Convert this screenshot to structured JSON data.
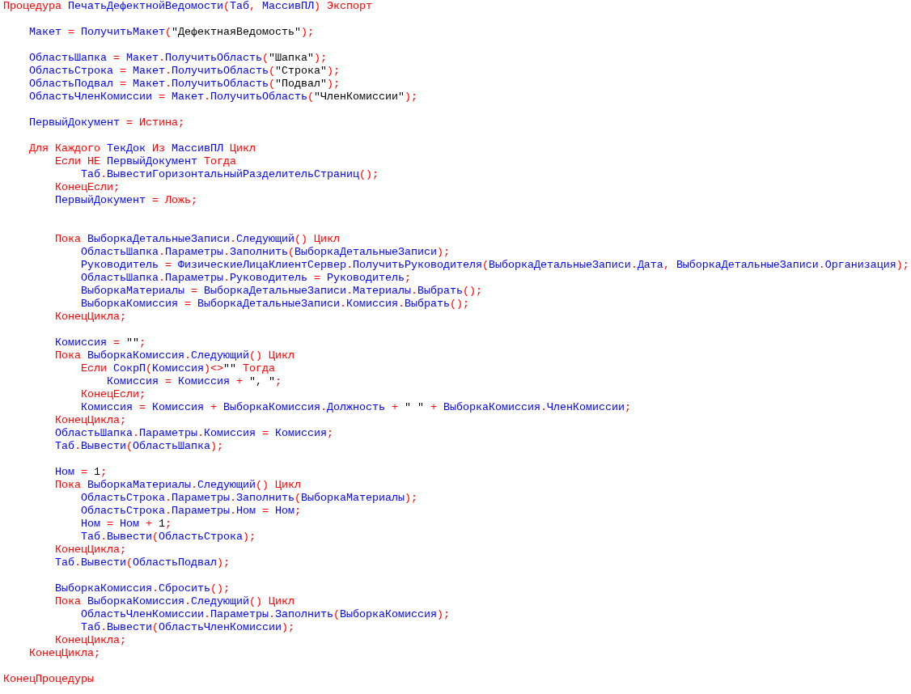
{
  "code_lines": [
    {
      "kind": "code",
      "tokens": [
        {
          "kind": "kw",
          "text": "Процедура"
        },
        {
          "kind": "id",
          "text": " ПечатьДефектнойВедомости"
        },
        {
          "kind": "op",
          "text": "("
        },
        {
          "kind": "id",
          "text": "Таб"
        },
        {
          "kind": "op",
          "text": ", "
        },
        {
          "kind": "id",
          "text": "МассивПЛ"
        },
        {
          "kind": "op",
          "text": ")"
        },
        {
          "kind": "kw",
          "text": " Экспорт"
        }
      ],
      "children": [
        {
          "kind": "blank"
        },
        {
          "kind": "code",
          "tokens": [
            {
              "kind": "id",
              "text": "Макет"
            },
            {
              "kind": "op",
              "text": " = "
            },
            {
              "kind": "id",
              "text": "ПолучитьМакет"
            },
            {
              "kind": "op",
              "text": "("
            },
            {
              "kind": "lit",
              "text": "\"ДефектнаяВедомость\""
            },
            {
              "kind": "op",
              "text": ");"
            }
          ]
        },
        {
          "kind": "blank"
        },
        {
          "kind": "code",
          "tokens": [
            {
              "kind": "id",
              "text": "ОбластьШапка"
            },
            {
              "kind": "op",
              "text": " = "
            },
            {
              "kind": "id",
              "text": "Макет"
            },
            {
              "kind": "op",
              "text": "."
            },
            {
              "kind": "id",
              "text": "ПолучитьОбласть"
            },
            {
              "kind": "op",
              "text": "("
            },
            {
              "kind": "lit",
              "text": "\"Шапка\""
            },
            {
              "kind": "op",
              "text": ");"
            }
          ]
        },
        {
          "kind": "code",
          "tokens": [
            {
              "kind": "id",
              "text": "ОбластьСтрока"
            },
            {
              "kind": "op",
              "text": " = "
            },
            {
              "kind": "id",
              "text": "Макет"
            },
            {
              "kind": "op",
              "text": "."
            },
            {
              "kind": "id",
              "text": "ПолучитьОбласть"
            },
            {
              "kind": "op",
              "text": "("
            },
            {
              "kind": "lit",
              "text": "\"Строка\""
            },
            {
              "kind": "op",
              "text": ");"
            }
          ]
        },
        {
          "kind": "code",
          "tokens": [
            {
              "kind": "id",
              "text": "ОбластьПодвал"
            },
            {
              "kind": "op",
              "text": " = "
            },
            {
              "kind": "id",
              "text": "Макет"
            },
            {
              "kind": "op",
              "text": "."
            },
            {
              "kind": "id",
              "text": "ПолучитьОбласть"
            },
            {
              "kind": "op",
              "text": "("
            },
            {
              "kind": "lit",
              "text": "\"Подвал\""
            },
            {
              "kind": "op",
              "text": ");"
            }
          ]
        },
        {
          "kind": "code",
          "tokens": [
            {
              "kind": "id",
              "text": "ОбластьЧленКомиссии"
            },
            {
              "kind": "op",
              "text": " = "
            },
            {
              "kind": "id",
              "text": "Макет"
            },
            {
              "kind": "op",
              "text": "."
            },
            {
              "kind": "id",
              "text": "ПолучитьОбласть"
            },
            {
              "kind": "op",
              "text": "("
            },
            {
              "kind": "lit",
              "text": "\"ЧленКомиссии\""
            },
            {
              "kind": "op",
              "text": ");"
            }
          ]
        },
        {
          "kind": "blank"
        },
        {
          "kind": "code",
          "tokens": [
            {
              "kind": "id",
              "text": "ПервыйДокумент"
            },
            {
              "kind": "op",
              "text": " = "
            },
            {
              "kind": "kw",
              "text": "Истина"
            },
            {
              "kind": "op",
              "text": ";"
            }
          ]
        },
        {
          "kind": "blank"
        },
        {
          "kind": "code",
          "tokens": [
            {
              "kind": "kw",
              "text": "Для Каждого"
            },
            {
              "kind": "id",
              "text": " ТекДок"
            },
            {
              "kind": "kw",
              "text": " Из"
            },
            {
              "kind": "id",
              "text": " МассивПЛ"
            },
            {
              "kind": "kw",
              "text": " Цикл"
            }
          ],
          "children": [
            {
              "kind": "code",
              "tokens": [
                {
                  "kind": "kw",
                  "text": "Если НЕ"
                },
                {
                  "kind": "id",
                  "text": " ПервыйДокумент"
                },
                {
                  "kind": "kw",
                  "text": " Тогда"
                }
              ],
              "children": [
                {
                  "kind": "code",
                  "tokens": [
                    {
                      "kind": "id",
                      "text": "Таб"
                    },
                    {
                      "kind": "op",
                      "text": "."
                    },
                    {
                      "kind": "id",
                      "text": "ВывестиГоризонтальныйРазделительСтраниц"
                    },
                    {
                      "kind": "op",
                      "text": "();"
                    }
                  ]
                }
              ]
            },
            {
              "kind": "code",
              "tokens": [
                {
                  "kind": "kw",
                  "text": "КонецЕсли"
                },
                {
                  "kind": "op",
                  "text": ";"
                }
              ]
            },
            {
              "kind": "code",
              "tokens": [
                {
                  "kind": "id",
                  "text": "ПервыйДокумент"
                },
                {
                  "kind": "op",
                  "text": " = "
                },
                {
                  "kind": "kw",
                  "text": "Ложь"
                },
                {
                  "kind": "op",
                  "text": ";"
                }
              ]
            },
            {
              "kind": "blank"
            },
            {
              "kind": "blank"
            },
            {
              "kind": "code",
              "tokens": [
                {
                  "kind": "kw",
                  "text": "Пока"
                },
                {
                  "kind": "id",
                  "text": " ВыборкаДетальныеЗаписи"
                },
                {
                  "kind": "op",
                  "text": "."
                },
                {
                  "kind": "id",
                  "text": "Следующий"
                },
                {
                  "kind": "op",
                  "text": "()"
                },
                {
                  "kind": "kw",
                  "text": " Цикл"
                }
              ],
              "children": [
                {
                  "kind": "code",
                  "tokens": [
                    {
                      "kind": "id",
                      "text": "ОбластьШапка"
                    },
                    {
                      "kind": "op",
                      "text": "."
                    },
                    {
                      "kind": "id",
                      "text": "Параметры"
                    },
                    {
                      "kind": "op",
                      "text": "."
                    },
                    {
                      "kind": "id",
                      "text": "Заполнить"
                    },
                    {
                      "kind": "op",
                      "text": "("
                    },
                    {
                      "kind": "id",
                      "text": "ВыборкаДетальныеЗаписи"
                    },
                    {
                      "kind": "op",
                      "text": ");"
                    }
                  ]
                },
                {
                  "kind": "code",
                  "tokens": [
                    {
                      "kind": "id",
                      "text": "Руководитель"
                    },
                    {
                      "kind": "op",
                      "text": " = "
                    },
                    {
                      "kind": "id",
                      "text": "ФизическиеЛицаКлиентСервер"
                    },
                    {
                      "kind": "op",
                      "text": "."
                    },
                    {
                      "kind": "id",
                      "text": "ПолучитьРуководителя"
                    },
                    {
                      "kind": "op",
                      "text": "("
                    },
                    {
                      "kind": "id",
                      "text": "ВыборкаДетальныеЗаписи"
                    },
                    {
                      "kind": "op",
                      "text": "."
                    },
                    {
                      "kind": "id",
                      "text": "Дата"
                    },
                    {
                      "kind": "op",
                      "text": ", "
                    },
                    {
                      "kind": "id",
                      "text": "ВыборкаДетальныеЗаписи"
                    },
                    {
                      "kind": "op",
                      "text": "."
                    },
                    {
                      "kind": "id",
                      "text": "Организация"
                    },
                    {
                      "kind": "op",
                      "text": ");"
                    }
                  ]
                },
                {
                  "kind": "code",
                  "tokens": [
                    {
                      "kind": "id",
                      "text": "ОбластьШапка"
                    },
                    {
                      "kind": "op",
                      "text": "."
                    },
                    {
                      "kind": "id",
                      "text": "Параметры"
                    },
                    {
                      "kind": "op",
                      "text": "."
                    },
                    {
                      "kind": "id",
                      "text": "Руководитель"
                    },
                    {
                      "kind": "op",
                      "text": " = "
                    },
                    {
                      "kind": "id",
                      "text": "Руководитель"
                    },
                    {
                      "kind": "op",
                      "text": ";"
                    }
                  ]
                },
                {
                  "kind": "code",
                  "tokens": [
                    {
                      "kind": "id",
                      "text": "ВыборкаМатериалы"
                    },
                    {
                      "kind": "op",
                      "text": " = "
                    },
                    {
                      "kind": "id",
                      "text": "ВыборкаДетальныеЗаписи"
                    },
                    {
                      "kind": "op",
                      "text": "."
                    },
                    {
                      "kind": "id",
                      "text": "Материалы"
                    },
                    {
                      "kind": "op",
                      "text": "."
                    },
                    {
                      "kind": "id",
                      "text": "Выбрать"
                    },
                    {
                      "kind": "op",
                      "text": "();"
                    }
                  ]
                },
                {
                  "kind": "code",
                  "tokens": [
                    {
                      "kind": "id",
                      "text": "ВыборкаКомиссия"
                    },
                    {
                      "kind": "op",
                      "text": " = "
                    },
                    {
                      "kind": "id",
                      "text": "ВыборкаДетальныеЗаписи"
                    },
                    {
                      "kind": "op",
                      "text": "."
                    },
                    {
                      "kind": "id",
                      "text": "Комиссия"
                    },
                    {
                      "kind": "op",
                      "text": "."
                    },
                    {
                      "kind": "id",
                      "text": "Выбрать"
                    },
                    {
                      "kind": "op",
                      "text": "();"
                    }
                  ]
                }
              ]
            },
            {
              "kind": "code",
              "tokens": [
                {
                  "kind": "kw",
                  "text": "КонецЦикла"
                },
                {
                  "kind": "op",
                  "text": ";"
                }
              ]
            },
            {
              "kind": "blank"
            },
            {
              "kind": "code",
              "tokens": [
                {
                  "kind": "id",
                  "text": "Комиссия"
                },
                {
                  "kind": "op",
                  "text": " = "
                },
                {
                  "kind": "lit",
                  "text": "\"\""
                },
                {
                  "kind": "op",
                  "text": ";"
                }
              ]
            },
            {
              "kind": "code",
              "tokens": [
                {
                  "kind": "kw",
                  "text": "Пока"
                },
                {
                  "kind": "id",
                  "text": " ВыборкаКомиссия"
                },
                {
                  "kind": "op",
                  "text": "."
                },
                {
                  "kind": "id",
                  "text": "Следующий"
                },
                {
                  "kind": "op",
                  "text": "()"
                },
                {
                  "kind": "kw",
                  "text": " Цикл"
                }
              ],
              "children": [
                {
                  "kind": "code",
                  "tokens": [
                    {
                      "kind": "kw",
                      "text": "Если"
                    },
                    {
                      "kind": "id",
                      "text": " СокрП"
                    },
                    {
                      "kind": "op",
                      "text": "("
                    },
                    {
                      "kind": "id",
                      "text": "Комиссия"
                    },
                    {
                      "kind": "op",
                      "text": ")<>"
                    },
                    {
                      "kind": "lit",
                      "text": "\"\""
                    },
                    {
                      "kind": "kw",
                      "text": " Тогда"
                    }
                  ],
                  "children": [
                    {
                      "kind": "code",
                      "tokens": [
                        {
                          "kind": "id",
                          "text": "Комиссия"
                        },
                        {
                          "kind": "op",
                          "text": " = "
                        },
                        {
                          "kind": "id",
                          "text": "Комиссия"
                        },
                        {
                          "kind": "op",
                          "text": " + "
                        },
                        {
                          "kind": "lit",
                          "text": "\", \""
                        },
                        {
                          "kind": "op",
                          "text": ";"
                        }
                      ]
                    }
                  ]
                },
                {
                  "kind": "code",
                  "tokens": [
                    {
                      "kind": "kw",
                      "text": "КонецЕсли"
                    },
                    {
                      "kind": "op",
                      "text": ";"
                    }
                  ]
                },
                {
                  "kind": "code",
                  "tokens": [
                    {
                      "kind": "id",
                      "text": "Комиссия"
                    },
                    {
                      "kind": "op",
                      "text": " = "
                    },
                    {
                      "kind": "id",
                      "text": "Комиссия"
                    },
                    {
                      "kind": "op",
                      "text": " + "
                    },
                    {
                      "kind": "id",
                      "text": "ВыборкаКомиссия"
                    },
                    {
                      "kind": "op",
                      "text": "."
                    },
                    {
                      "kind": "id",
                      "text": "Должность"
                    },
                    {
                      "kind": "op",
                      "text": " + "
                    },
                    {
                      "kind": "lit",
                      "text": "\" \""
                    },
                    {
                      "kind": "op",
                      "text": " + "
                    },
                    {
                      "kind": "id",
                      "text": "ВыборкаКомиссия"
                    },
                    {
                      "kind": "op",
                      "text": "."
                    },
                    {
                      "kind": "id",
                      "text": "ЧленКомиссии"
                    },
                    {
                      "kind": "op",
                      "text": ";"
                    }
                  ]
                }
              ]
            },
            {
              "kind": "code",
              "tokens": [
                {
                  "kind": "kw",
                  "text": "КонецЦикла"
                },
                {
                  "kind": "op",
                  "text": ";"
                }
              ]
            },
            {
              "kind": "code",
              "tokens": [
                {
                  "kind": "id",
                  "text": "ОбластьШапка"
                },
                {
                  "kind": "op",
                  "text": "."
                },
                {
                  "kind": "id",
                  "text": "Параметры"
                },
                {
                  "kind": "op",
                  "text": "."
                },
                {
                  "kind": "id",
                  "text": "Комиссия"
                },
                {
                  "kind": "op",
                  "text": " = "
                },
                {
                  "kind": "id",
                  "text": "Комиссия"
                },
                {
                  "kind": "op",
                  "text": ";"
                }
              ]
            },
            {
              "kind": "code",
              "tokens": [
                {
                  "kind": "id",
                  "text": "Таб"
                },
                {
                  "kind": "op",
                  "text": "."
                },
                {
                  "kind": "id",
                  "text": "Вывести"
                },
                {
                  "kind": "op",
                  "text": "("
                },
                {
                  "kind": "id",
                  "text": "ОбластьШапка"
                },
                {
                  "kind": "op",
                  "text": ");"
                }
              ]
            },
            {
              "kind": "blank"
            },
            {
              "kind": "code",
              "tokens": [
                {
                  "kind": "id",
                  "text": "Ном"
                },
                {
                  "kind": "op",
                  "text": " = "
                },
                {
                  "kind": "lit",
                  "text": "1"
                },
                {
                  "kind": "op",
                  "text": ";"
                }
              ]
            },
            {
              "kind": "code",
              "tokens": [
                {
                  "kind": "kw",
                  "text": "Пока"
                },
                {
                  "kind": "id",
                  "text": " ВыборкаМатериалы"
                },
                {
                  "kind": "op",
                  "text": "."
                },
                {
                  "kind": "id",
                  "text": "Следующий"
                },
                {
                  "kind": "op",
                  "text": "()"
                },
                {
                  "kind": "kw",
                  "text": " Цикл"
                }
              ],
              "children": [
                {
                  "kind": "code",
                  "tokens": [
                    {
                      "kind": "id",
                      "text": "ОбластьСтрока"
                    },
                    {
                      "kind": "op",
                      "text": "."
                    },
                    {
                      "kind": "id",
                      "text": "Параметры"
                    },
                    {
                      "kind": "op",
                      "text": "."
                    },
                    {
                      "kind": "id",
                      "text": "Заполнить"
                    },
                    {
                      "kind": "op",
                      "text": "("
                    },
                    {
                      "kind": "id",
                      "text": "ВыборкаМатериалы"
                    },
                    {
                      "kind": "op",
                      "text": ");"
                    }
                  ]
                },
                {
                  "kind": "code",
                  "tokens": [
                    {
                      "kind": "id",
                      "text": "ОбластьСтрока"
                    },
                    {
                      "kind": "op",
                      "text": "."
                    },
                    {
                      "kind": "id",
                      "text": "Параметры"
                    },
                    {
                      "kind": "op",
                      "text": "."
                    },
                    {
                      "kind": "id",
                      "text": "Ном"
                    },
                    {
                      "kind": "op",
                      "text": " = "
                    },
                    {
                      "kind": "id",
                      "text": "Ном"
                    },
                    {
                      "kind": "op",
                      "text": ";"
                    }
                  ]
                },
                {
                  "kind": "code",
                  "tokens": [
                    {
                      "kind": "id",
                      "text": "Ном"
                    },
                    {
                      "kind": "op",
                      "text": " = "
                    },
                    {
                      "kind": "id",
                      "text": "Ном"
                    },
                    {
                      "kind": "op",
                      "text": " + "
                    },
                    {
                      "kind": "lit",
                      "text": "1"
                    },
                    {
                      "kind": "op",
                      "text": ";"
                    }
                  ]
                },
                {
                  "kind": "code",
                  "tokens": [
                    {
                      "kind": "id",
                      "text": "Таб"
                    },
                    {
                      "kind": "op",
                      "text": "."
                    },
                    {
                      "kind": "id",
                      "text": "Вывести"
                    },
                    {
                      "kind": "op",
                      "text": "("
                    },
                    {
                      "kind": "id",
                      "text": "ОбластьСтрока"
                    },
                    {
                      "kind": "op",
                      "text": ");"
                    }
                  ]
                }
              ]
            },
            {
              "kind": "code",
              "tokens": [
                {
                  "kind": "kw",
                  "text": "КонецЦикла"
                },
                {
                  "kind": "op",
                  "text": ";"
                }
              ]
            },
            {
              "kind": "code",
              "tokens": [
                {
                  "kind": "id",
                  "text": "Таб"
                },
                {
                  "kind": "op",
                  "text": "."
                },
                {
                  "kind": "id",
                  "text": "Вывести"
                },
                {
                  "kind": "op",
                  "text": "("
                },
                {
                  "kind": "id",
                  "text": "ОбластьПодвал"
                },
                {
                  "kind": "op",
                  "text": ");"
                }
              ]
            },
            {
              "kind": "blank"
            },
            {
              "kind": "code",
              "tokens": [
                {
                  "kind": "id",
                  "text": "ВыборкаКомиссия"
                },
                {
                  "kind": "op",
                  "text": "."
                },
                {
                  "kind": "id",
                  "text": "Сбросить"
                },
                {
                  "kind": "op",
                  "text": "();"
                }
              ]
            },
            {
              "kind": "code",
              "tokens": [
                {
                  "kind": "kw",
                  "text": "Пока"
                },
                {
                  "kind": "id",
                  "text": " ВыборкаКомиссия"
                },
                {
                  "kind": "op",
                  "text": "."
                },
                {
                  "kind": "id",
                  "text": "Следующий"
                },
                {
                  "kind": "op",
                  "text": "()"
                },
                {
                  "kind": "kw",
                  "text": " Цикл"
                }
              ],
              "children": [
                {
                  "kind": "code",
                  "tokens": [
                    {
                      "kind": "id",
                      "text": "ОбластьЧленКомиссии"
                    },
                    {
                      "kind": "op",
                      "text": "."
                    },
                    {
                      "kind": "id",
                      "text": "Параметры"
                    },
                    {
                      "kind": "op",
                      "text": "."
                    },
                    {
                      "kind": "id",
                      "text": "Заполнить"
                    },
                    {
                      "kind": "op",
                      "text": "("
                    },
                    {
                      "kind": "id",
                      "text": "ВыборкаКомиссия"
                    },
                    {
                      "kind": "op",
                      "text": ");"
                    }
                  ]
                },
                {
                  "kind": "code",
                  "tokens": [
                    {
                      "kind": "id",
                      "text": "Таб"
                    },
                    {
                      "kind": "op",
                      "text": "."
                    },
                    {
                      "kind": "id",
                      "text": "Вывести"
                    },
                    {
                      "kind": "op",
                      "text": "("
                    },
                    {
                      "kind": "id",
                      "text": "ОбластьЧленКомиссии"
                    },
                    {
                      "kind": "op",
                      "text": ");"
                    }
                  ]
                }
              ]
            },
            {
              "kind": "code",
              "tokens": [
                {
                  "kind": "kw",
                  "text": "КонецЦикла"
                },
                {
                  "kind": "op",
                  "text": ";"
                }
              ]
            }
          ]
        },
        {
          "kind": "code",
          "tokens": [
            {
              "kind": "kw",
              "text": "КонецЦикла"
            },
            {
              "kind": "op",
              "text": ";"
            }
          ]
        },
        {
          "kind": "blank"
        }
      ]
    },
    {
      "kind": "code",
      "tokens": [
        {
          "kind": "kw",
          "text": "КонецПроцедуры"
        }
      ]
    }
  ]
}
